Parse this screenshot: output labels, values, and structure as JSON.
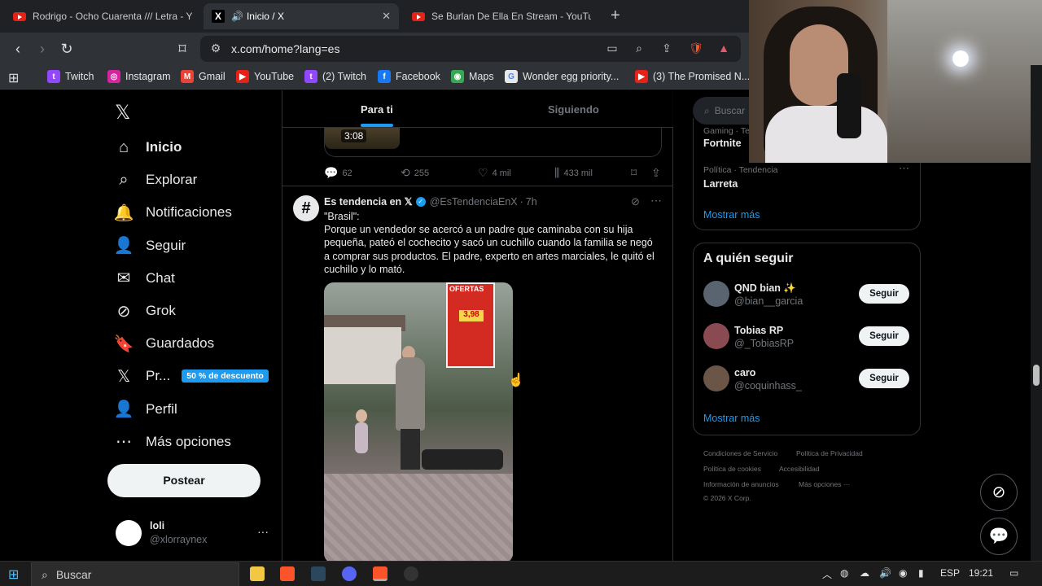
{
  "browser": {
    "tabs": [
      {
        "title": "Rodrigo - Ocho Cuarenta /// Letra - Y",
        "icon": "youtube-icon"
      },
      {
        "title": "Inicio / X",
        "icon": "x-icon",
        "audio": "🔊"
      },
      {
        "title": "Se Burlan De Ella En Stream - YouTub",
        "icon": "youtube-icon"
      }
    ],
    "new_tab": "+",
    "url": "x.com/home?lang=es",
    "bookmarks": [
      {
        "label": "Twitch",
        "color": "#9146ff",
        "glyph": "t"
      },
      {
        "label": "Instagram",
        "color": "#d6249f",
        "glyph": "◎"
      },
      {
        "label": "Gmail",
        "color": "#ea4335",
        "glyph": "M"
      },
      {
        "label": "YouTube",
        "color": "#e62117",
        "glyph": "▶"
      },
      {
        "label": "(2) Twitch",
        "color": "#9146ff",
        "glyph": "t"
      },
      {
        "label": "Facebook",
        "color": "#1877f2",
        "glyph": "f"
      },
      {
        "label": "Maps",
        "color": "#34a853",
        "glyph": "◉"
      },
      {
        "label": "Wonder egg priority...",
        "color": "#e8e8e8",
        "glyph": "G"
      },
      {
        "label": "(3) The Promised N...",
        "color": "#e62117",
        "glyph": "▶"
      }
    ]
  },
  "sidebar": {
    "logo": "𝕏",
    "items": [
      {
        "label": "Inicio",
        "icon": "⌂"
      },
      {
        "label": "Explorar",
        "icon": "⌕"
      },
      {
        "label": "Notificaciones",
        "icon": "🔔"
      },
      {
        "label": "Seguir",
        "icon": "👤"
      },
      {
        "label": "Chat",
        "icon": "✉"
      },
      {
        "label": "Grok",
        "icon": "⊘"
      },
      {
        "label": "Guardados",
        "icon": "🔖"
      },
      {
        "label": "Pr...",
        "icon": "𝕏",
        "badge": "50 % de descuento"
      },
      {
        "label": "Perfil",
        "icon": "👤"
      },
      {
        "label": "Más opciones",
        "icon": "⋯"
      }
    ],
    "post_button": "Postear",
    "account": {
      "name": "loli",
      "handle": "@xlorraynex",
      "more": "···"
    }
  },
  "timeline": {
    "tabs": [
      "Para ti",
      "Siguiendo"
    ],
    "prev_post": {
      "duration": "3:08",
      "replies": "62",
      "reposts": "255",
      "likes": "4 mil",
      "views": "433 mil"
    },
    "post": {
      "author": "Es tendencia en 𝕏",
      "handle": "@EsTendenciaEnX",
      "time": "7h",
      "meta_sep": "·",
      "line1": "\"Brasil\":",
      "body": "Porque un vendedor se acercó a un padre que caminaba con su hija pequeña, pateó el cochecito y sacó un cuchillo cuando la familia se negó a comprar sus productos.  El padre, experto en artes marciales, le quitó el cuchillo y lo mató.",
      "sign_text": "OFERTAS",
      "sign_price": "3,98"
    }
  },
  "right": {
    "search_placeholder": "Buscar",
    "trends": [
      {
        "category": "Gaming · Te",
        "name": "Fortnite"
      },
      {
        "category": "Política · Tendencia",
        "name": "Larreta"
      }
    ],
    "show_more": "Mostrar más",
    "follow_title": "A quién seguir",
    "suggestions": [
      {
        "name": "QND bian ✨",
        "handle": "@bian__garcia",
        "button": "Seguir"
      },
      {
        "name": "Tobias RP",
        "handle": "@_TobiasRP",
        "button": "Seguir"
      },
      {
        "name": "caro",
        "handle": "@coquinhass_",
        "button": "Seguir"
      }
    ],
    "show_more_2": "Mostrar más",
    "footer": [
      "Condiciones de Servicio",
      "Política de Privacidad",
      "Política de cookies",
      "Accesibilidad",
      "Información de anuncios",
      "Más opciones ···",
      "© 2026 X Corp."
    ]
  },
  "taskbar": {
    "search": "Buscar",
    "lang": "ESP",
    "time": "19:21"
  }
}
